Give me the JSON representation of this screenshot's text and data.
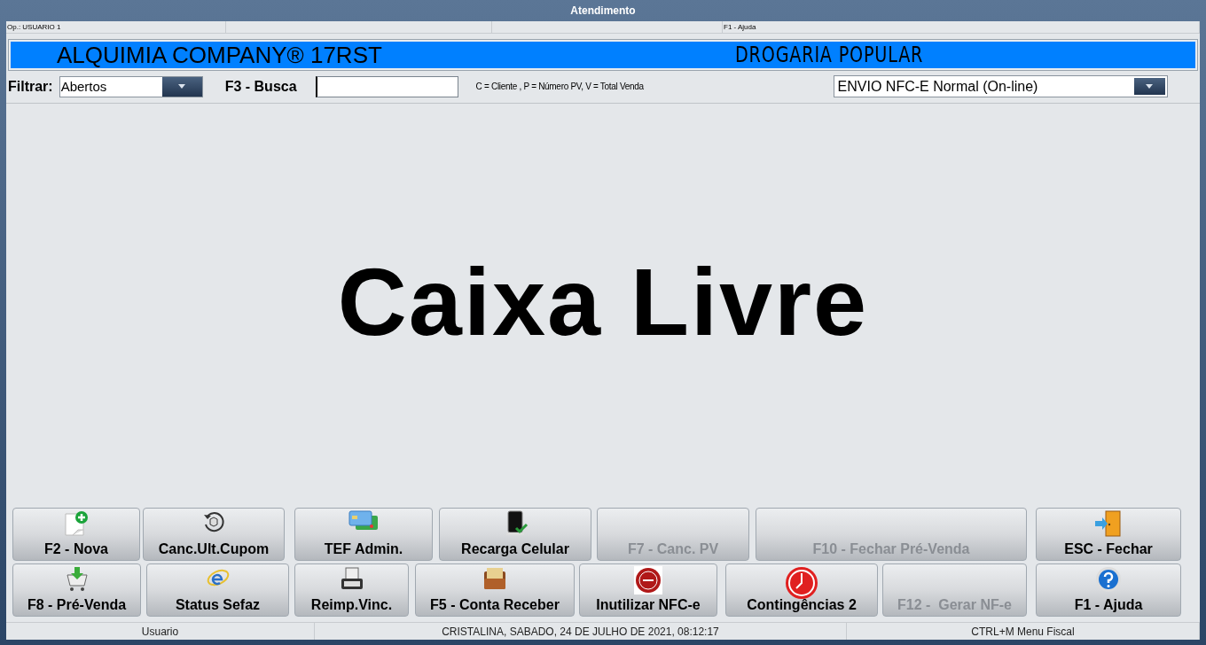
{
  "window": {
    "title": "Atendimento"
  },
  "top_status": {
    "operator": "Op.: USUARIO 1",
    "help": "F1 - Ajuda"
  },
  "banner": {
    "company": "ALQUIMIA COMPANY® 17RST",
    "store": "DROGARIA POPULAR"
  },
  "filter": {
    "label": "Filtrar:",
    "value": "Abertos"
  },
  "search": {
    "label": "F3 - Busca",
    "hint": "C = Cliente , P = Número PV, V = Total Venda"
  },
  "nfce_mode": {
    "value": "ENVIO NFC-E Normal (On-line)"
  },
  "main_message": "Caixa Livre",
  "button_rows": [
    [
      {
        "label": "F2 - Nova",
        "disabled": false
      },
      {
        "label": "Canc.Ult.Cupom",
        "disabled": false
      },
      {
        "label": "TEF Admin.",
        "disabled": false
      },
      {
        "label": "Recarga Celular",
        "disabled": false
      },
      {
        "label": "F7 - Canc. PV",
        "disabled": true
      },
      {
        "label": "F10 - Fechar Pré-Venda",
        "disabled": true
      },
      {
        "label": "ESC - Fechar",
        "disabled": false
      }
    ],
    [
      {
        "label": "F8 - Pré-Venda",
        "disabled": false
      },
      {
        "label": "Status Sefaz",
        "disabled": false
      },
      {
        "label": "Reimp.Vinc.",
        "disabled": false
      },
      {
        "label": "F5 - Conta Receber",
        "disabled": false
      },
      {
        "label": "Inutilizar NFC-e",
        "disabled": false
      },
      {
        "label": "Contingências 2",
        "disabled": false
      },
      {
        "label": "F12 -  Gerar NF-e",
        "disabled": true
      },
      {
        "label": "F1 - Ajuda",
        "disabled": false
      }
    ]
  ],
  "status_bar": [
    "Usuario",
    "CRISTALINA, SABADO, 24 DE JULHO DE 2021, 08:12:17",
    "CTRL+M Menu Fiscal"
  ]
}
